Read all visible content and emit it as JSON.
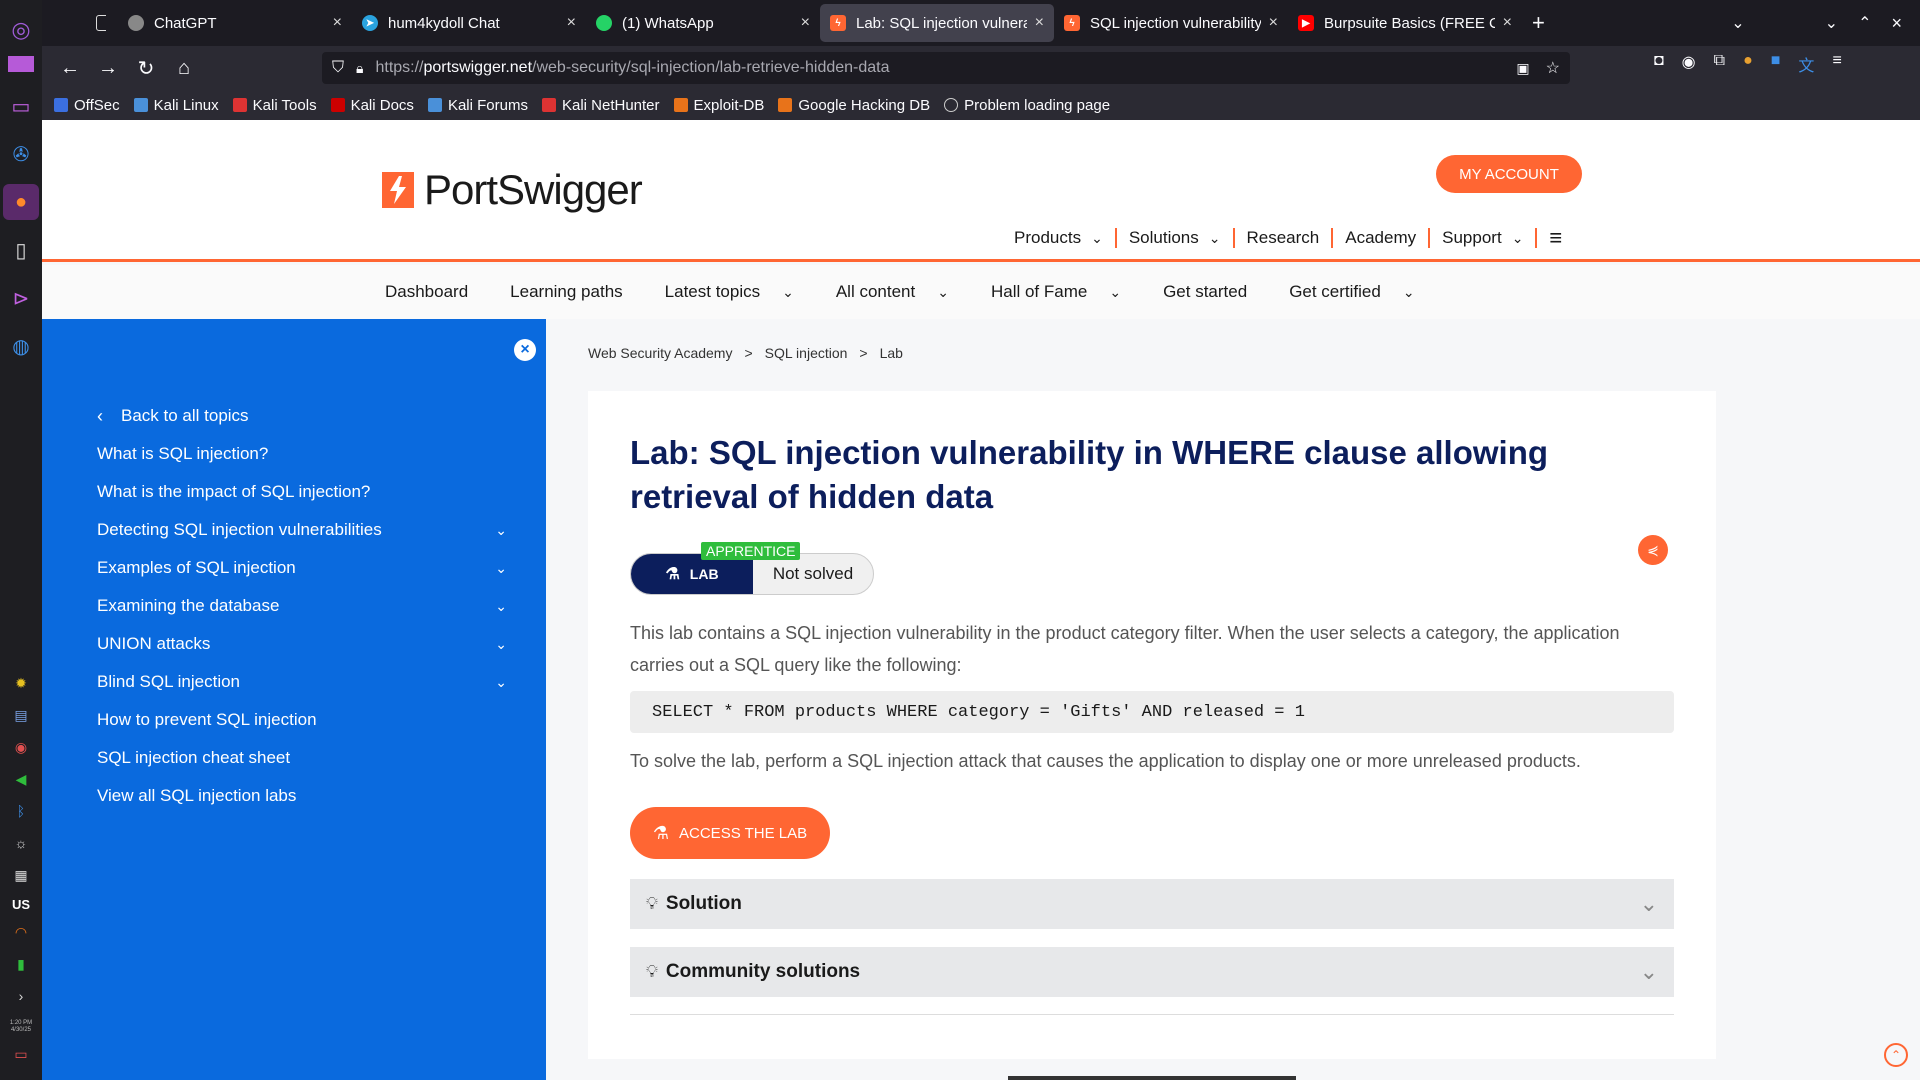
{
  "tabs": [
    {
      "label": "",
      "icon": "tab-overview-icon",
      "fav_color": "#1c1b22"
    },
    {
      "label": "ChatGPT",
      "icon": "chatgpt-icon",
      "fav_color": "#888888"
    },
    {
      "label": "hum4kydoll Chat",
      "icon": "telegram-icon",
      "fav_color": "#2aa3df"
    },
    {
      "label": "(1) WhatsApp",
      "icon": "whatsapp-icon",
      "fav_color": "#25d366"
    },
    {
      "label": "Lab: SQL injection vulnerab",
      "icon": "portswigger-icon",
      "fav_color": "#ff6633"
    },
    {
      "label": "SQL injection vulnerability",
      "icon": "portswigger-icon",
      "fav_color": "#ff6633"
    },
    {
      "label": "Burpsuite Basics (FREE Co",
      "icon": "youtube-icon",
      "fav_color": "#ff0000"
    }
  ],
  "url": {
    "scheme": "https://",
    "host": "portswigger.net",
    "path": "/web-security/sql-injection/lab-retrieve-hidden-data"
  },
  "bookmarks": [
    {
      "label": "OffSec",
      "color": "#3b6fe0"
    },
    {
      "label": "Kali Linux",
      "color": "#4a90d9"
    },
    {
      "label": "Kali Tools",
      "color": "#d33"
    },
    {
      "label": "Kali Docs",
      "color": "#c00"
    },
    {
      "label": "Kali Forums",
      "color": "#4a90d9"
    },
    {
      "label": "Kali NetHunter",
      "color": "#d33"
    },
    {
      "label": "Exploit-DB",
      "color": "#e8731a"
    },
    {
      "label": "Google Hacking DB",
      "color": "#e8731a"
    },
    {
      "label": "Problem loading page",
      "color": "#999"
    }
  ],
  "header": {
    "logo_text": "PortSwigger",
    "account_button": "MY ACCOUNT",
    "nav": [
      {
        "label": "Products",
        "dropdown": true
      },
      {
        "label": "Solutions",
        "dropdown": true
      },
      {
        "label": "Research",
        "dropdown": false
      },
      {
        "label": "Academy",
        "dropdown": false
      },
      {
        "label": "Support",
        "dropdown": true
      }
    ]
  },
  "subnav": [
    {
      "label": "Dashboard",
      "dropdown": false
    },
    {
      "label": "Learning paths",
      "dropdown": false
    },
    {
      "label": "Latest topics",
      "dropdown": true
    },
    {
      "label": "All content",
      "dropdown": true
    },
    {
      "label": "Hall of Fame",
      "dropdown": true
    },
    {
      "label": "Get started",
      "dropdown": false
    },
    {
      "label": "Get certified",
      "dropdown": true
    }
  ],
  "sidebar": {
    "back": "Back to all topics",
    "items": [
      {
        "label": "What is SQL injection?",
        "expandable": false
      },
      {
        "label": "What is the impact of SQL injection?",
        "expandable": false
      },
      {
        "label": "Detecting SQL injection vulnerabilities",
        "expandable": true
      },
      {
        "label": "Examples of SQL injection",
        "expandable": true
      },
      {
        "label": "Examining the database",
        "expandable": true
      },
      {
        "label": "UNION attacks",
        "expandable": true
      },
      {
        "label": "Blind SQL injection",
        "expandable": true
      },
      {
        "label": "How to prevent SQL injection",
        "expandable": false
      },
      {
        "label": "SQL injection cheat sheet",
        "expandable": false
      },
      {
        "label": "View all SQL injection labs",
        "expandable": false
      }
    ]
  },
  "breadcrumb": [
    "Web Security Academy",
    "SQL injection",
    "Lab"
  ],
  "lab": {
    "title": "Lab: SQL injection vulnerability in WHERE clause allowing retrieval of hidden data",
    "level": "APPRENTICE",
    "badge": "LAB",
    "status": "Not solved",
    "description": "This lab contains a SQL injection vulnerability in the product category filter. When the user selects a category, the application carries out a SQL query like the following:",
    "code": "SELECT * FROM products WHERE category = 'Gifts' AND released = 1",
    "goal": "To solve the lab, perform a SQL injection attack that causes the application to display one or more unreleased products.",
    "access_button": "ACCESS THE LAB",
    "solution": "Solution",
    "community": "Community solutions"
  },
  "dock": {
    "keyboard_layout": "US",
    "clock_time": "1:20 PM",
    "clock_date": "4/30/25"
  }
}
